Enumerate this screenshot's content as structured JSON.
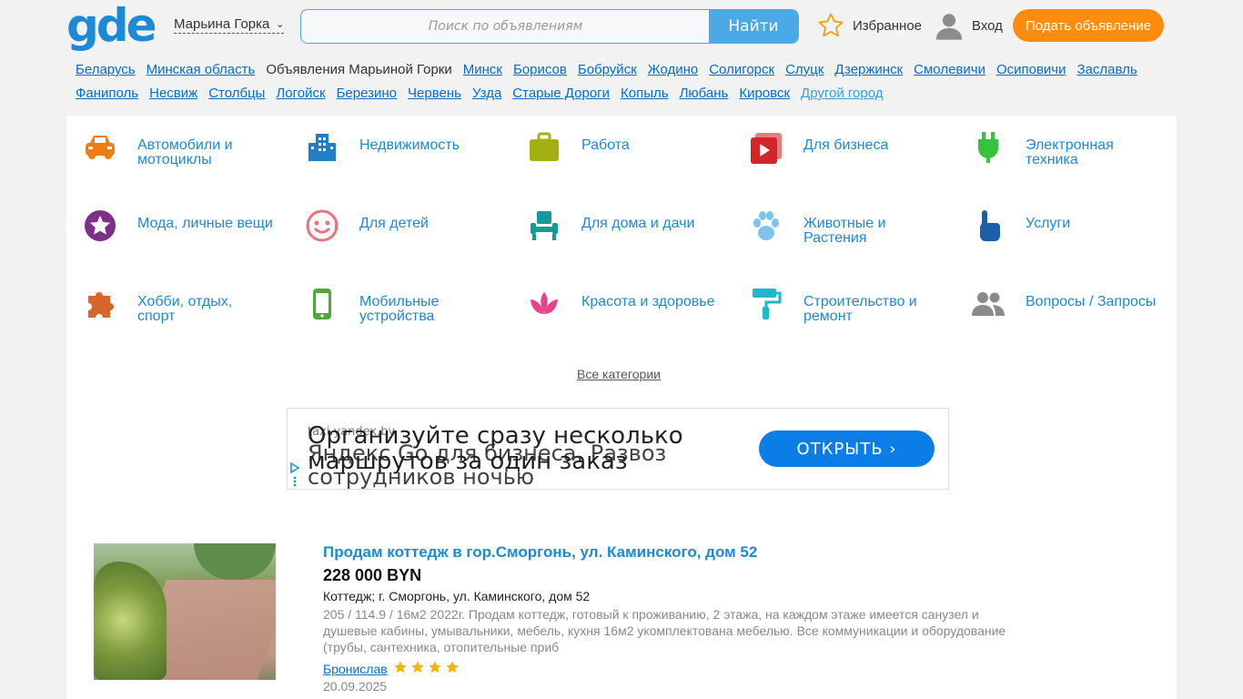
{
  "header": {
    "logo": "gde",
    "city": "Марьина Горка",
    "search_placeholder": "Поиск по объявлениям",
    "search_button": "Найти",
    "favorites": "Избранное",
    "login": "Вход",
    "post_button": "Подать объявление"
  },
  "city_links": [
    {
      "label": "Беларусь"
    },
    {
      "label": "Минская область"
    },
    {
      "label": "Объявления Марьиной Горки"
    },
    {
      "label": "Минск"
    },
    {
      "label": "Борисов"
    },
    {
      "label": "Бобруйск"
    },
    {
      "label": "Жодино"
    },
    {
      "label": "Солигорск"
    },
    {
      "label": "Слуцк"
    },
    {
      "label": "Дзержинск"
    },
    {
      "label": "Смолевичи"
    },
    {
      "label": "Осиповичи"
    },
    {
      "label": "Заславль"
    },
    {
      "label": "Фаниполь"
    },
    {
      "label": "Несвиж"
    },
    {
      "label": "Столбцы"
    },
    {
      "label": "Логойск"
    },
    {
      "label": "Березино"
    },
    {
      "label": "Червень"
    },
    {
      "label": "Узда"
    },
    {
      "label": "Старые Дороги"
    },
    {
      "label": "Копыль"
    },
    {
      "label": "Любань"
    },
    {
      "label": "Кировск"
    },
    {
      "label": "Другой город"
    }
  ],
  "categories": [
    {
      "label": "Автомобили и мотоциклы",
      "icon": "car-icon",
      "color": "#f07d14"
    },
    {
      "label": "Недвижимость",
      "icon": "building-icon",
      "color": "#1e7fc6"
    },
    {
      "label": "Работа",
      "icon": "briefcase-icon",
      "color": "#a2b012"
    },
    {
      "label": "Для бизнеса",
      "icon": "video-play-icon",
      "color": "#d3242a"
    },
    {
      "label": "Электронная техника",
      "icon": "plug-icon",
      "color": "#33c33c"
    },
    {
      "label": "Мода, личные вещи",
      "icon": "star-badge-icon",
      "color": "#7d2f8a"
    },
    {
      "label": "Для детей",
      "icon": "smiley-icon",
      "color": "#e8757a"
    },
    {
      "label": "Для дома и дачи",
      "icon": "armchair-icon",
      "color": "#159a9a"
    },
    {
      "label": "Животные и Растения",
      "icon": "paw-icon",
      "color": "#7cc4ee"
    },
    {
      "label": "Услуги",
      "icon": "hand-pointer-icon",
      "color": "#1e5da8"
    },
    {
      "label": "Хобби, отдых, спорт",
      "icon": "puzzle-icon",
      "color": "#d8652a"
    },
    {
      "label": "Мобильные устройства",
      "icon": "smartphone-icon",
      "color": "#4ea83a"
    },
    {
      "label": "Красота и здоровье",
      "icon": "lotus-icon",
      "color": "#e8418c"
    },
    {
      "label": "Строительство и ремонт",
      "icon": "paint-roller-icon",
      "color": "#1fb7c9"
    },
    {
      "label": "Вопросы / Запросы",
      "icon": "people-icon",
      "color": "#8a8a8a"
    }
  ],
  "all_categories": "Все категории",
  "ad": {
    "domain": "taxi.yandex.by",
    "headline": "Организуйте сразу несколько маршрутов за один заказ",
    "headline2": "Яндекс Go для бизнеса. Развоз сотрудников ночью",
    "open_button": "ОТКРЫТЬ"
  },
  "listing": {
    "title": "Продам коттедж в гор.Сморгонь, ул. Каминского, дом 52",
    "price": "228 000 BYN",
    "subtitle": "Коттедж; г. Сморгонь, ул. Каминского, дом 52",
    "description": "205 / 114.9 / 16м2 2022г. Продам коттедж, готовый к проживанию, 2 этажа, на каждом этаже имеется санузел и душевые кабины, умывальники, мебель, кухня 16м2 укомплектована мебелью. Все коммуникации и оборудование (трубы, сантехника, отопительные приб",
    "seller": "Бронислав",
    "stars": 4,
    "date": "20.09.2025"
  },
  "colors": {
    "brand_blue": "#1e8ad6",
    "accent_orange": "#ff8c0e",
    "link_blue": "#0a6cc4",
    "star_yellow": "#f4b400"
  }
}
